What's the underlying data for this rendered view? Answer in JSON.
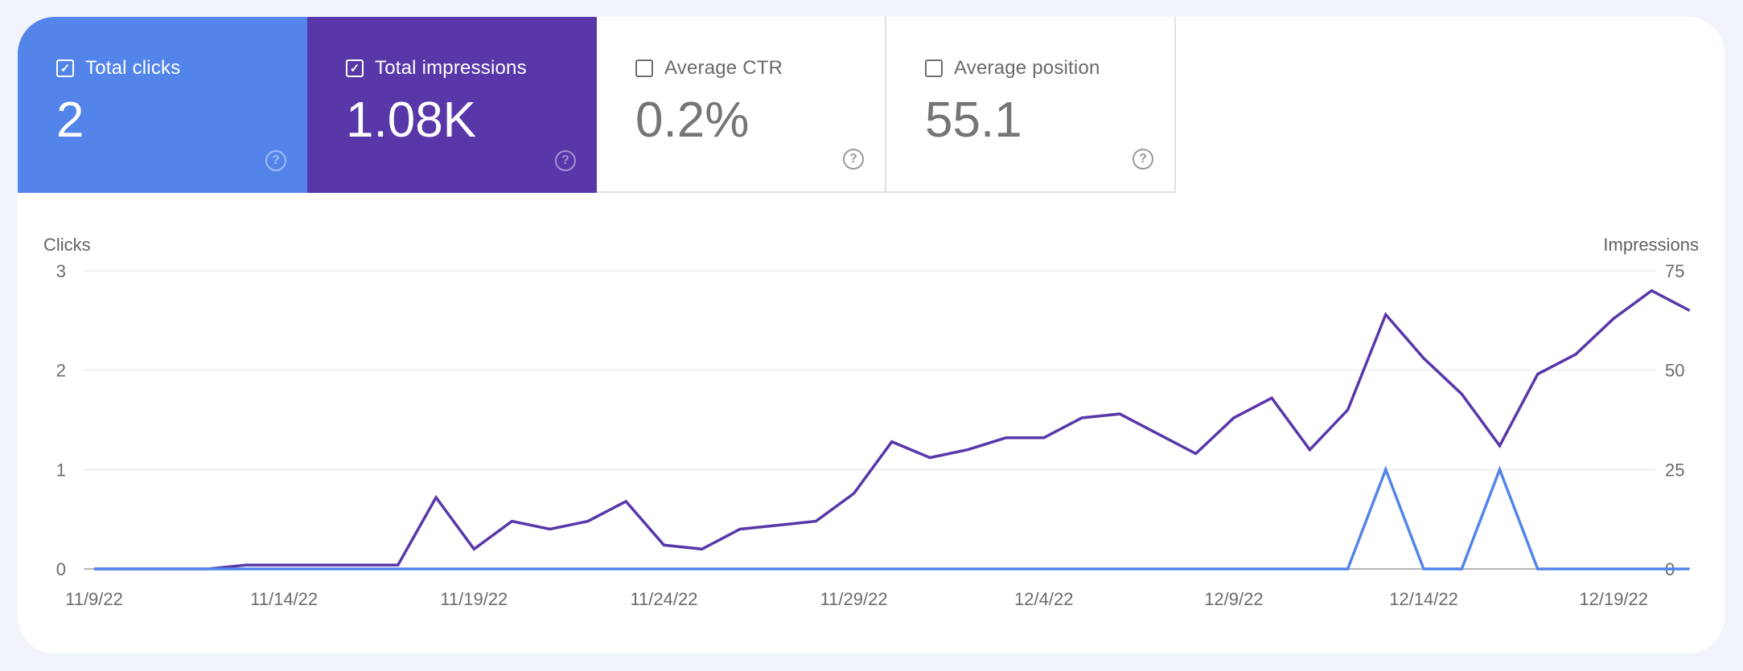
{
  "metrics": [
    {
      "key": "clicks",
      "label": "Total clicks",
      "value": "2",
      "checked": true,
      "color": "#5384ea"
    },
    {
      "key": "impressions",
      "label": "Total impressions",
      "value": "1.08K",
      "checked": true,
      "color": "#5837a9"
    },
    {
      "key": "ctr",
      "label": "Average CTR",
      "value": "0.2%",
      "checked": false
    },
    {
      "key": "position",
      "label": "Average position",
      "value": "55.1",
      "checked": false
    }
  ],
  "help_icon": "?",
  "check_icon": "✓",
  "chart_data": {
    "type": "line",
    "title": "",
    "left_axis_label": "Clicks",
    "right_axis_label": "Impressions",
    "left_ylim": [
      0,
      3
    ],
    "right_ylim": [
      0,
      75
    ],
    "left_ticks": [
      "0",
      "1",
      "2",
      "3"
    ],
    "right_ticks": [
      "0",
      "25",
      "50",
      "75"
    ],
    "grid": true,
    "xlabel_ticks": [
      "11/9/22",
      "11/14/22",
      "11/19/22",
      "11/24/22",
      "11/29/22",
      "12/4/22",
      "12/9/22",
      "12/14/22",
      "12/19/22"
    ],
    "x_start": "11/9/22",
    "x_end": "12/20/22",
    "series": [
      {
        "name": "Impressions",
        "axis": "right",
        "color": "#5837a9",
        "values": [
          0,
          0,
          0,
          0,
          1,
          1,
          1,
          1,
          1,
          18,
          5,
          12,
          10,
          12,
          17,
          6,
          5,
          10,
          11,
          12,
          19,
          32,
          28,
          30,
          33,
          33,
          38,
          39,
          34,
          29,
          38,
          43,
          30,
          40,
          64,
          53,
          44,
          31,
          49,
          54,
          63,
          70,
          65
        ]
      },
      {
        "name": "Clicks",
        "axis": "left",
        "color": "#5384ea",
        "values": [
          0,
          0,
          0,
          0,
          0,
          0,
          0,
          0,
          0,
          0,
          0,
          0,
          0,
          0,
          0,
          0,
          0,
          0,
          0,
          0,
          0,
          0,
          0,
          0,
          0,
          0,
          0,
          0,
          0,
          0,
          0,
          0,
          0,
          0,
          1,
          0,
          0,
          1,
          0,
          0,
          0,
          0,
          0
        ]
      }
    ]
  }
}
